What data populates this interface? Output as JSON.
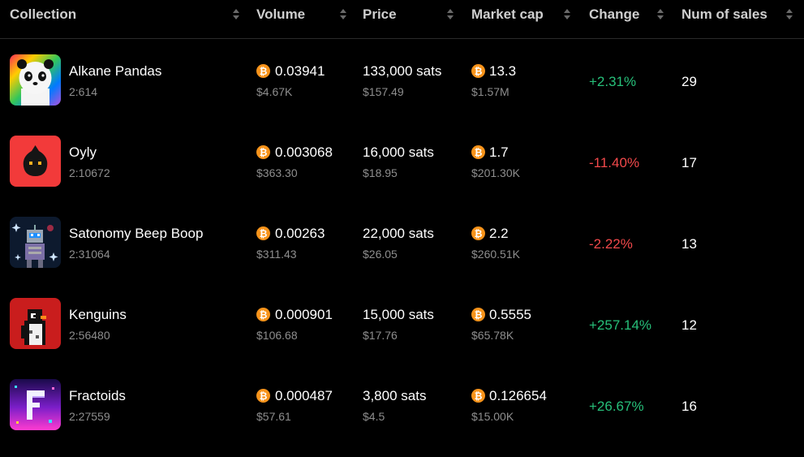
{
  "columns": {
    "collection": "Collection",
    "volume": "Volume",
    "price": "Price",
    "market_cap": "Market cap",
    "change": "Change",
    "num_sales": "Num of sales"
  },
  "rows": [
    {
      "name": "Alkane Pandas",
      "id": "2:614",
      "volume_btc": "0.03941",
      "volume_usd": "$4.67K",
      "price_sats": "133,000 sats",
      "price_usd": "$157.49",
      "mcap_btc": "13.3",
      "mcap_usd": "$1.57M",
      "change": "+2.31%",
      "change_dir": "up",
      "sales": "29",
      "thumb_icon": "panda-icon"
    },
    {
      "name": "Oyly",
      "id": "2:10672",
      "volume_btc": "0.003068",
      "volume_usd": "$363.30",
      "price_sats": "16,000 sats",
      "price_usd": "$18.95",
      "mcap_btc": "1.7",
      "mcap_usd": "$201.30K",
      "change": "-11.40%",
      "change_dir": "down",
      "sales": "17",
      "thumb_icon": "oil-drop-icon"
    },
    {
      "name": "Satonomy Beep Boop",
      "id": "2:31064",
      "volume_btc": "0.00263",
      "volume_usd": "$311.43",
      "price_sats": "22,000 sats",
      "price_usd": "$26.05",
      "mcap_btc": "2.2",
      "mcap_usd": "$260.51K",
      "change": "-2.22%",
      "change_dir": "down",
      "sales": "13",
      "thumb_icon": "robot-icon"
    },
    {
      "name": "Kenguins",
      "id": "2:56480",
      "volume_btc": "0.000901",
      "volume_usd": "$106.68",
      "price_sats": "15,000 sats",
      "price_usd": "$17.76",
      "mcap_btc": "0.5555",
      "mcap_usd": "$65.78K",
      "change": "+257.14%",
      "change_dir": "up",
      "sales": "12",
      "thumb_icon": "penguin-icon"
    },
    {
      "name": "Fractoids",
      "id": "2:27559",
      "volume_btc": "0.000487",
      "volume_usd": "$57.61",
      "price_sats": "3,800 sats",
      "price_usd": "$4.5",
      "mcap_btc": "0.126654",
      "mcap_usd": "$15.00K",
      "change": "+26.67%",
      "change_dir": "up",
      "sales": "16",
      "thumb_icon": "letter-f-icon"
    }
  ],
  "colors": {
    "positive": "#27c07a",
    "negative": "#f2494b",
    "bitcoin": "#f7931a",
    "background": "#000000"
  },
  "icons": {
    "currency": "bitcoin-icon",
    "sort": "sort-arrows-icon"
  }
}
